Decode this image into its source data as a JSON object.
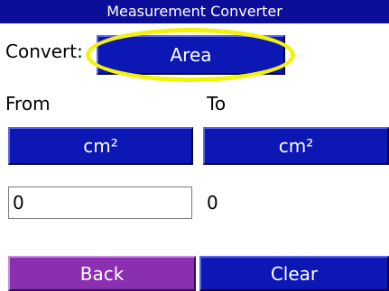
{
  "title": "Measurement Converter",
  "convert": {
    "label": "Convert:",
    "value": "Area"
  },
  "from": {
    "label": "From",
    "unit": "cm²",
    "value": "0"
  },
  "to": {
    "label": "To",
    "unit": "cm²",
    "value": "0"
  },
  "buttons": {
    "back": "Back",
    "clear": "Clear"
  },
  "colors": {
    "title_bar": "#0c0e9a",
    "button": "#0c17b4",
    "back_button": "#8a2fb0",
    "highlight": "#f2f20c"
  }
}
